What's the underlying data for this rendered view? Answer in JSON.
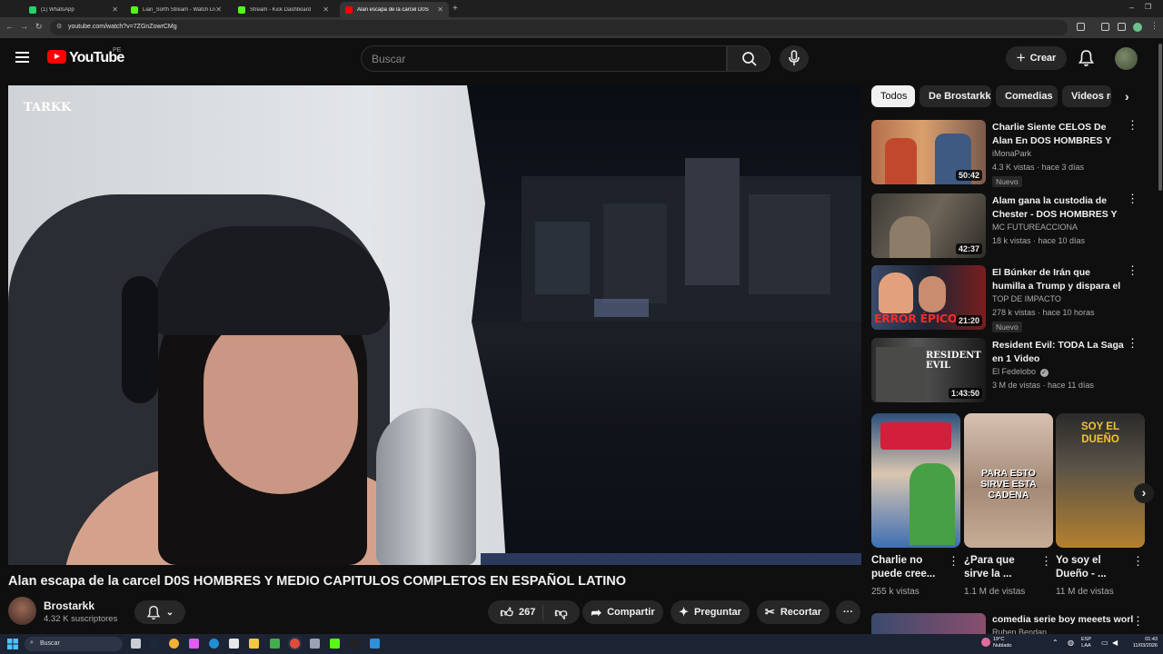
{
  "browser": {
    "tabs": [
      {
        "label": "(1) WhatsApp",
        "fav_color": "#25d366"
      },
      {
        "label": "Lian_Sorth Stream - Watch Live",
        "fav_color": "#53fc18"
      },
      {
        "label": "Stream - Kick Dashboard",
        "fav_color": "#53fc18"
      },
      {
        "label": "Alan escapa de la carcel D0S",
        "fav_color": "#ff0000"
      }
    ],
    "url": "youtube.com/watch?v=7ZGnZowrCMg"
  },
  "header": {
    "logo_text": "YouTube",
    "country": "PE",
    "search_placeholder": "Buscar",
    "create_label": "Crear"
  },
  "video": {
    "watermark": "TARKK",
    "title": "Alan escapa de la carcel D0S HOMBRES Y MEDIO CAPITULOS COMPLETOS EN ESPAÑOL LATINO",
    "channel": "Brostarkk",
    "subscribers": "4.32 K suscriptores",
    "likes": "267",
    "share_label": "Compartir",
    "ask_label": "Preguntar",
    "clip_label": "Recortar"
  },
  "chips": [
    "Todos",
    "De Brostarkk",
    "Comedias",
    "Videos relacionados"
  ],
  "recommendations": [
    {
      "title": "Charlie Siente CELOS De Alan En DOS HOMBRES Y MEDIO ...",
      "channel": "iMonaPark",
      "meta": "4.3 K vistas · hace 3 días",
      "badge": "Nuevo",
      "duration": "50:42"
    },
    {
      "title": "Alam gana la custodia de Chester  - DOS HOMBRES Y ...",
      "channel": "MC FUTUREACCIONA",
      "meta": "18 k vistas · hace 10 días",
      "badge": "",
      "duration": "42:37"
    },
    {
      "title": "El Búnker de Irán que humilla a Trump y dispara el Petróleo. ...",
      "channel": "TOP DE IMPACTO",
      "meta": "278 k vistas · hace 10 horas",
      "badge": "Nuevo",
      "duration": "21:20",
      "thumb_text": "ERROR ÉPICO"
    },
    {
      "title": "Resident Evil: TODA La Saga en 1 Video",
      "channel": "El Fedelobo",
      "meta": "3 M de vistas · hace 11 días",
      "badge": "",
      "duration": "1:43:50",
      "thumb_text": "RESIDENT EVIL"
    }
  ],
  "shorts": [
    {
      "title": "Charlie no puede cree...",
      "views": "255 k vistas",
      "thumb_text": ""
    },
    {
      "title": "¿Para que sirve la ...",
      "views": "1.1 M de vistas",
      "thumb_text": "PARA ESTO SIRVE ESTA CADENA"
    },
    {
      "title": "Yo soy el Dueño - ...",
      "views": "11 M de vistas",
      "thumb_text": "SOY EL DUEÑO"
    }
  ],
  "next_rec": {
    "title": "comedia serie boy meeets worl",
    "channel": "Ruben Bendan"
  },
  "taskbar": {
    "search_label": "Buscar",
    "weather": "19°C",
    "weather_desc": "Nublado",
    "lang_top": "ESP",
    "lang_bottom": "LAA",
    "time": "01:43",
    "date": "11/03/2026"
  }
}
